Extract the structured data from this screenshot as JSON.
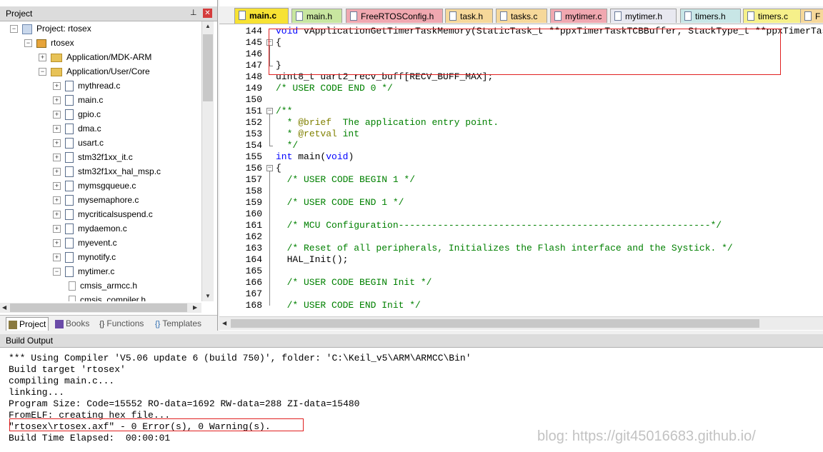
{
  "project_panel": {
    "title": "Project",
    "pin_icon": "pin-icon",
    "close_icon": "close-icon",
    "tree": [
      {
        "label": "Project: rtosex",
        "icon": "project-icon",
        "expander": "−"
      },
      {
        "label": "rtosex",
        "icon": "target-icon",
        "expander": "−"
      },
      {
        "label": "Application/MDK-ARM",
        "icon": "folder-icon",
        "expander": "+"
      },
      {
        "label": "Application/User/Core",
        "icon": "folder-icon",
        "expander": "−"
      },
      {
        "label": "mythread.c",
        "icon": "file-icon",
        "expander": "+"
      },
      {
        "label": "main.c",
        "icon": "file-icon",
        "expander": "+"
      },
      {
        "label": "gpio.c",
        "icon": "file-icon",
        "expander": "+"
      },
      {
        "label": "dma.c",
        "icon": "file-icon",
        "expander": "+"
      },
      {
        "label": "usart.c",
        "icon": "file-icon",
        "expander": "+"
      },
      {
        "label": "stm32f1xx_it.c",
        "icon": "file-icon",
        "expander": "+"
      },
      {
        "label": "stm32f1xx_hal_msp.c",
        "icon": "file-icon",
        "expander": "+"
      },
      {
        "label": "mymsgqueue.c",
        "icon": "file-icon",
        "expander": "+"
      },
      {
        "label": "mysemaphore.c",
        "icon": "file-icon",
        "expander": "+"
      },
      {
        "label": "mycriticalsuspend.c",
        "icon": "file-icon",
        "expander": "+"
      },
      {
        "label": "mydaemon.c",
        "icon": "file-icon",
        "expander": "+"
      },
      {
        "label": "myevent.c",
        "icon": "file-icon",
        "expander": "+"
      },
      {
        "label": "mynotify.c",
        "icon": "file-icon",
        "expander": "+"
      },
      {
        "label": "mytimer.c",
        "icon": "file-icon",
        "expander": "−"
      },
      {
        "label": "cmsis_armcc.h",
        "icon": "header-file-icon",
        "expander": ""
      },
      {
        "label": "cmsis_compiler.h",
        "icon": "header-file-icon",
        "expander": ""
      }
    ],
    "bottom_tabs": [
      {
        "label": "Project",
        "icon": "project-tab-icon",
        "active": true
      },
      {
        "label": "Books",
        "icon": "books-icon",
        "active": false
      },
      {
        "label": "Functions",
        "icon": "functions-icon",
        "active": false
      },
      {
        "label": "Templates",
        "icon": "templates-icon",
        "active": false
      }
    ]
  },
  "editor": {
    "tabs": [
      {
        "label": "main.c",
        "color": "#f7e233",
        "active": true
      },
      {
        "label": "main.h",
        "color": "#c8e6a0",
        "active": false
      },
      {
        "label": "FreeRTOSConfig.h",
        "color": "#f0a8b0",
        "active": false
      },
      {
        "label": "task.h",
        "color": "#f6d89a",
        "active": false
      },
      {
        "label": "tasks.c",
        "color": "#f6d89a",
        "active": false
      },
      {
        "label": "mytimer.c",
        "color": "#f0a8b0",
        "active": false
      },
      {
        "label": "mytimer.h",
        "color": "#e8e8f0",
        "active": false
      },
      {
        "label": "timers.h",
        "color": "#c8e6e6",
        "active": false
      },
      {
        "label": "timers.c",
        "color": "#f6f08a",
        "active": false
      },
      {
        "label": "F",
        "color": "#f6d89a",
        "active": false
      }
    ],
    "lines": [
      {
        "num": "144",
        "fold": "",
        "segments": [
          {
            "t": "void",
            "c": "kw"
          },
          {
            "t": " vApplicationGetTimerTaskMemory(StaticTask_t **ppxTimerTaskTCBBuffer, StackType_t **ppxTimerTaskSt",
            "c": ""
          }
        ]
      },
      {
        "num": "145",
        "fold": "−",
        "segments": [
          {
            "t": "{",
            "c": ""
          }
        ]
      },
      {
        "num": "146",
        "fold": "",
        "segments": []
      },
      {
        "num": "147",
        "fold": "",
        "segments": [
          {
            "t": "}",
            "c": ""
          }
        ]
      },
      {
        "num": "148",
        "fold": "",
        "segments": [
          {
            "t": "uint8_t uart2_recv_buff[RECV_BUFF_MAX];",
            "c": ""
          }
        ]
      },
      {
        "num": "149",
        "fold": "",
        "segments": [
          {
            "t": "/* USER CODE END 0 */",
            "c": "cm"
          }
        ]
      },
      {
        "num": "150",
        "fold": "",
        "segments": []
      },
      {
        "num": "151",
        "fold": "−",
        "segments": [
          {
            "t": "/**",
            "c": "cm"
          }
        ]
      },
      {
        "num": "152",
        "fold": "",
        "segments": [
          {
            "t": "  * ",
            "c": "cm"
          },
          {
            "t": "@brief",
            "c": "doc"
          },
          {
            "t": "  The application entry point.",
            "c": "cm"
          }
        ]
      },
      {
        "num": "153",
        "fold": "",
        "segments": [
          {
            "t": "  * ",
            "c": "cm"
          },
          {
            "t": "@retval",
            "c": "doc"
          },
          {
            "t": " int",
            "c": "cm"
          }
        ]
      },
      {
        "num": "154",
        "fold": "",
        "segments": [
          {
            "t": "  */",
            "c": "cm"
          }
        ]
      },
      {
        "num": "155",
        "fold": "",
        "segments": [
          {
            "t": "int",
            "c": "kw"
          },
          {
            "t": " main(",
            "c": ""
          },
          {
            "t": "void",
            "c": "kw"
          },
          {
            "t": ")",
            "c": ""
          }
        ]
      },
      {
        "num": "156",
        "fold": "−",
        "segments": [
          {
            "t": "{",
            "c": ""
          }
        ]
      },
      {
        "num": "157",
        "fold": "",
        "segments": [
          {
            "t": "  /* USER CODE BEGIN 1 */",
            "c": "cm"
          }
        ]
      },
      {
        "num": "158",
        "fold": "",
        "segments": []
      },
      {
        "num": "159",
        "fold": "",
        "segments": [
          {
            "t": "  /* USER CODE END 1 */",
            "c": "cm"
          }
        ]
      },
      {
        "num": "160",
        "fold": "",
        "segments": []
      },
      {
        "num": "161",
        "fold": "",
        "segments": [
          {
            "t": "  /* MCU Configuration--------------------------------------------------------*/",
            "c": "cm"
          }
        ]
      },
      {
        "num": "162",
        "fold": "",
        "segments": []
      },
      {
        "num": "163",
        "fold": "",
        "segments": [
          {
            "t": "  /* Reset of all peripherals, Initializes the Flash interface and the Systick. */",
            "c": "cm"
          }
        ]
      },
      {
        "num": "164",
        "fold": "",
        "segments": [
          {
            "t": "  HAL_Init();",
            "c": ""
          }
        ]
      },
      {
        "num": "165",
        "fold": "",
        "segments": []
      },
      {
        "num": "166",
        "fold": "",
        "segments": [
          {
            "t": "  /* USER CODE BEGIN Init */",
            "c": "cm"
          }
        ]
      },
      {
        "num": "167",
        "fold": "",
        "segments": []
      },
      {
        "num": "168",
        "fold": "",
        "segments": [
          {
            "t": "  /* USER CODE END Init */",
            "c": "cm"
          }
        ]
      }
    ]
  },
  "build_output": {
    "title": "Build Output",
    "lines": [
      "*** Using Compiler 'V5.06 update 6 (build 750)', folder: 'C:\\Keil_v5\\ARM\\ARMCC\\Bin'",
      "Build target 'rtosex'",
      "compiling main.c...",
      "linking...",
      "Program Size: Code=15552 RO-data=1692 RW-data=288 ZI-data=15480",
      "FromELF: creating hex file...",
      "\"rtosex\\rtosex.axf\" - 0 Error(s), 0 Warning(s).",
      "Build Time Elapsed:  00:00:01"
    ]
  },
  "watermark": "blog: https://git45016683.github.io/",
  "colors": {
    "keyword": "#0000ff",
    "comment": "#008000",
    "doc_tag": "#808000",
    "highlight": "#e02020",
    "active_tab": "#f7e233"
  }
}
